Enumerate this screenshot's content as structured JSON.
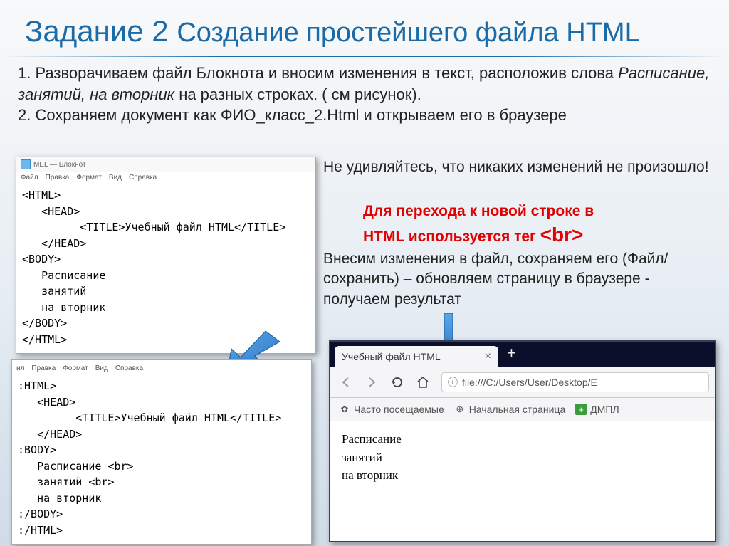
{
  "title_big": "Задание 2 ",
  "title_rest": "Создание простейшего файла HTML",
  "step1_a": "1. Разворачиваем файл Блокнота и вносим изменения в текст, расположив слова ",
  "step1_it": "Расписание, занятий, на вторник ",
  "step1_b": "на разных строках. ( см рисунок).",
  "step2": "2. Сохраняем документ как ФИО_класс_2.Html и открываем его в браузере",
  "notepad": {
    "title": "MEL — Блокнот",
    "menu": [
      "Файл",
      "Правка",
      "Формат",
      "Вид",
      "Справка"
    ],
    "code1": "<HTML>\n   <HEAD>\n         <TITLE>Учебный файл HTML</TITLE>\n   </HEAD>\n<BODY>\n   Расписание\n   занятий\n   на вторник\n</BODY>\n</HTML>",
    "menu2": [
      "ил",
      "Правка",
      "Формат",
      "Вид",
      "Справка"
    ],
    "code2": ":HTML>\n   <HEAD>\n         <TITLE>Учебный файл HTML</TITLE>\n   </HEAD>\n:BODY>\n   Расписание <br>\n   занятий <br>\n   на вторник\n:/BODY>\n:/HTML>"
  },
  "right": {
    "line1": "Не удивляйтесь, что никаких изменений не произошло!",
    "red1": "Для перехода к новой строке в",
    "red2a": "HTML используется тег ",
    "red2b": "<br>",
    "line3": "Внесим изменения в файл, сохраняем его (Файл/сохранить) – обновляем страницу в браузере - получаем результат"
  },
  "browser": {
    "tab_title": "Учебный файл HTML",
    "url": "file:///C:/Users/User/Desktop/E",
    "bookmarks": [
      "Часто посещаемые",
      "Начальная страница",
      "ДМПЛ"
    ],
    "body": [
      "Расписание",
      "занятий",
      "на вторник"
    ]
  }
}
